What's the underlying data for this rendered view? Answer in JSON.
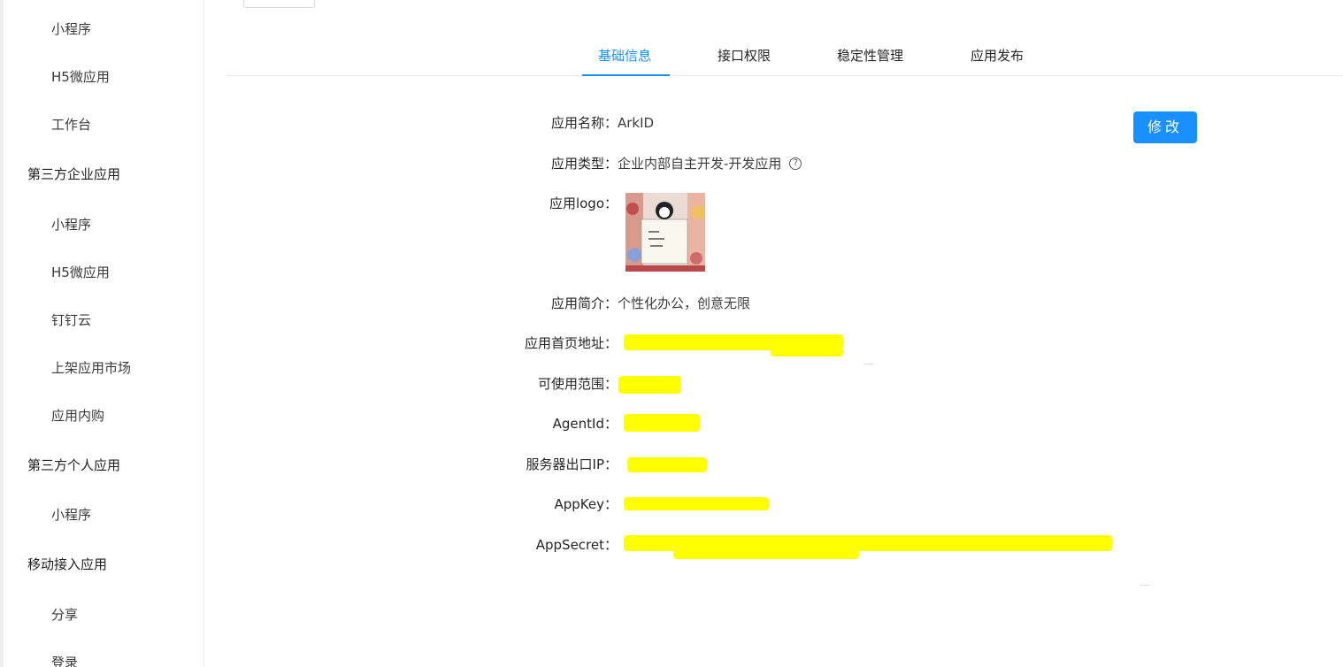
{
  "sidebar": {
    "items": [
      {
        "label": "小程序",
        "level": "sub"
      },
      {
        "label": "H5微应用",
        "level": "sub"
      },
      {
        "label": "工作台",
        "level": "sub"
      },
      {
        "label": "第三方企业应用",
        "level": "group"
      },
      {
        "label": "小程序",
        "level": "sub"
      },
      {
        "label": "H5微应用",
        "level": "sub"
      },
      {
        "label": "钉钉云",
        "level": "sub"
      },
      {
        "label": "上架应用市场",
        "level": "sub"
      },
      {
        "label": "应用内购",
        "level": "sub"
      },
      {
        "label": "第三方个人应用",
        "level": "group"
      },
      {
        "label": "小程序",
        "level": "sub"
      },
      {
        "label": "移动接入应用",
        "level": "group"
      },
      {
        "label": "分享",
        "level": "sub"
      },
      {
        "label": "登录",
        "level": "sub"
      }
    ]
  },
  "tabs": [
    {
      "label": "基础信息",
      "active": true
    },
    {
      "label": "接口权限",
      "active": false
    },
    {
      "label": "稳定性管理",
      "active": false
    },
    {
      "label": "应用发布",
      "active": false
    }
  ],
  "info": {
    "edit_label": "修改",
    "fields": [
      {
        "label": "应用名称：",
        "value": "ArkID"
      },
      {
        "label": "应用类型：",
        "value": "企业内部自主开发-开发应用"
      },
      {
        "label": "应用logo：",
        "value": ""
      },
      {
        "label": "应用简介：",
        "value": "个性化办公，创意无限"
      },
      {
        "label": "应用首页地址：",
        "value": ""
      },
      {
        "label": "可使用范围：",
        "value": ""
      },
      {
        "label": "AgentId：",
        "value": ""
      },
      {
        "label": "服务器出口IP：",
        "value": ""
      },
      {
        "label": "AppKey：",
        "value": ""
      },
      {
        "label": "AppSecret：",
        "value": ""
      }
    ]
  },
  "icons": {
    "help": "question-circle-icon",
    "logo": "app-logo-image"
  },
  "colors": {
    "accent": "#1890ff",
    "redaction": "#ffff00"
  }
}
